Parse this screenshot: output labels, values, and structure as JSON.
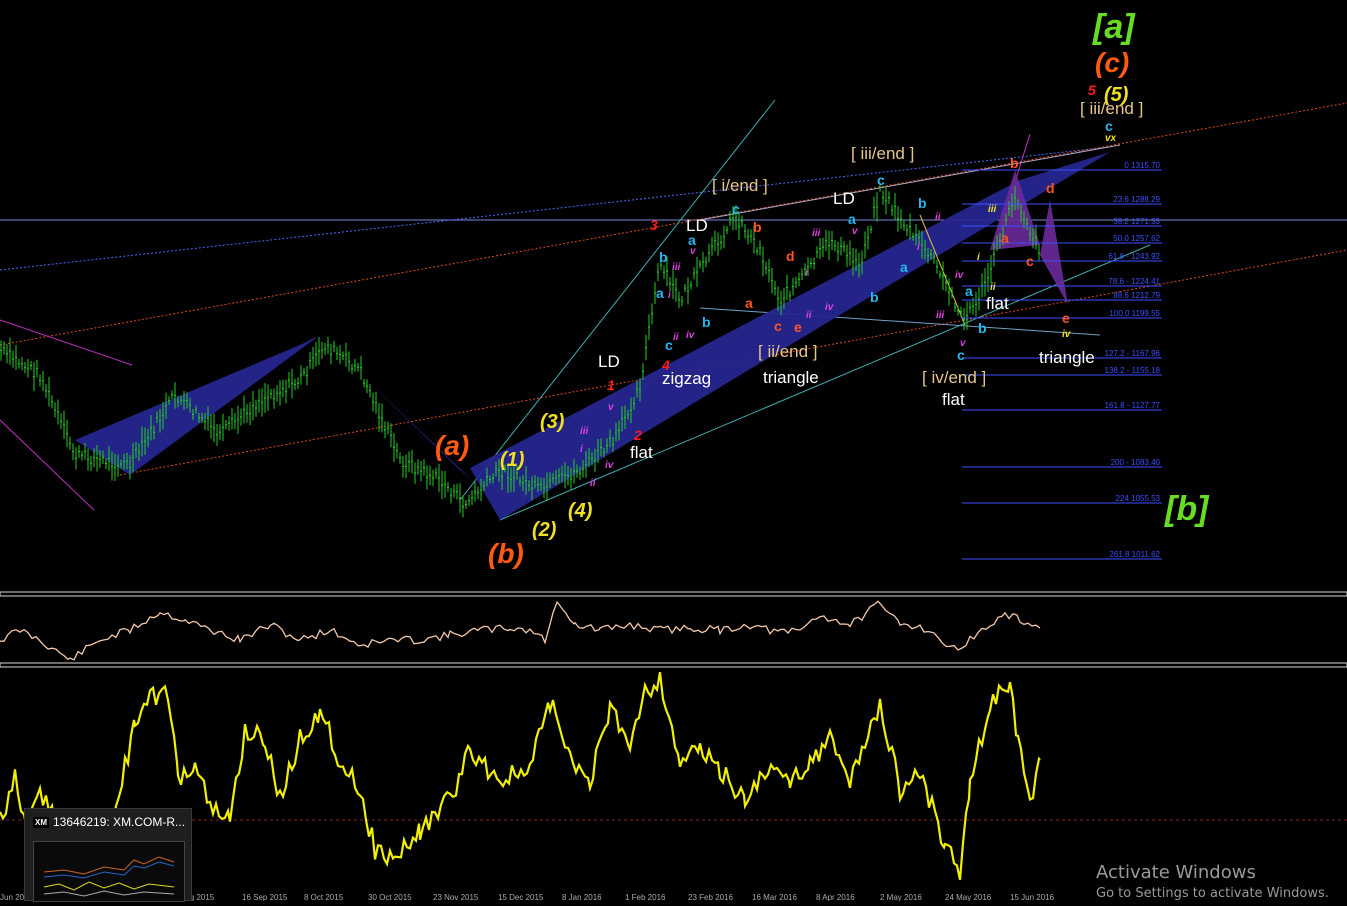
{
  "labels": {
    "major_a": "[a]",
    "major_b": "[b]",
    "major_c": "(c)",
    "paren_a": "(a)",
    "paren_b": "(b)",
    "paren_1": "(1)",
    "paren_2": "(2)",
    "paren_3": "(3)",
    "paren_4": "(4)",
    "paren_5": "(5)",
    "red_1": "1",
    "red_2": "2",
    "red_3": "3",
    "red_4": "4",
    "red_5": "5",
    "ld_1": "LD",
    "ld_2": "LD",
    "ld_3": "LD",
    "i_end": "[ i/end ]",
    "ii_end": "[ ii/end ]",
    "iii_end_1": "[ iii/end ]",
    "iii_end_2": "[ iii/end ]",
    "iv_end": "[ iv/end ]",
    "zigzag": "zigzag",
    "triangle_1": "triangle",
    "triangle_2": "triangle",
    "flat_1": "flat",
    "flat_2": "flat",
    "flat_3": "flat",
    "lc_a": "a",
    "lc_b": "b",
    "lc_c": "c",
    "lc_d": "d",
    "lc_e": "e",
    "r_i": "i",
    "r_ii": "ii",
    "r_iii": "iii",
    "r_iv": "iv",
    "r_v": "v",
    "r_vx": "vx"
  },
  "fib_levels": [
    {
      "label": "0 1315.70"
    },
    {
      "label": "23.6 1288.29"
    },
    {
      "label": "38.2 1271.33"
    },
    {
      "label": "50.0 1257.62"
    },
    {
      "label": "61.8 - 1243.92"
    },
    {
      "label": "78.6 - 1224.41"
    },
    {
      "label": "88.6 1212.79"
    },
    {
      "label": "100.0 1199.55"
    },
    {
      "label": "127.2 - 1167.96"
    },
    {
      "label": "138.2 - 1155.18"
    },
    {
      "label": "161.8 - 1127.77"
    },
    {
      "label": "200 - 1083.40"
    },
    {
      "label": "224 1055.53"
    },
    {
      "label": "261.8 1011.62"
    }
  ],
  "dates": [
    "Jun 20",
    "Aug 2015",
    "16 Sep 2015",
    "8 Oct 2015",
    "30 Oct 2015",
    "23 Nov 2015",
    "15 Dec 2015",
    "8 Jan 2016",
    "1 Feb 2016",
    "23 Feb 2016",
    "16 Mar 2016",
    "8 Apr 2016",
    "2 May 2016",
    "24 May 2016",
    "15 Jun 2016"
  ],
  "taskbar_thumb": {
    "logo": "XM",
    "title": "13646219: XM.COM-R..."
  },
  "watermark": {
    "title": "Activate Windows",
    "subtitle": "Go to Settings to activate Windows."
  },
  "colors": {
    "candle": "#22cc22",
    "channel": "#26268f",
    "oscillator_upper": "#f5c8a8",
    "oscillator_lower": "#f0f000",
    "fib": "#3b4fff"
  }
}
